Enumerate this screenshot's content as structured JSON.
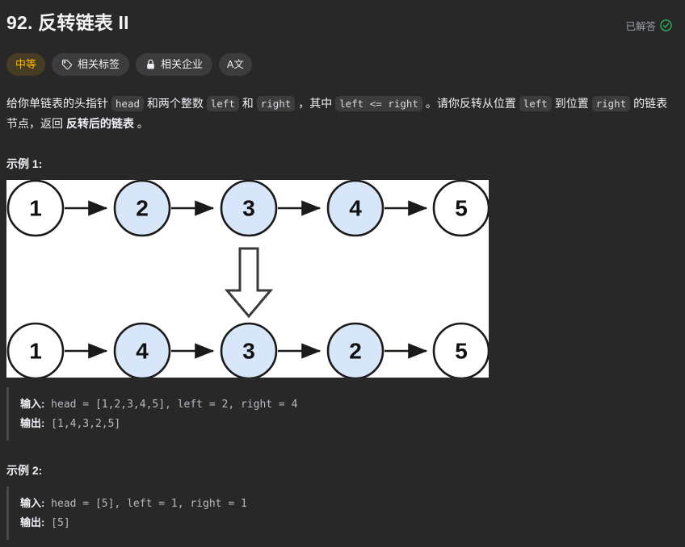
{
  "header": {
    "title": "92. 反转链表 II",
    "status_label": "已解答",
    "status_icon": "check-circle-icon",
    "status_color": "#2db55d"
  },
  "pills": [
    {
      "label": "中等",
      "icon": null,
      "kind": "difficulty",
      "color": "#ffb800"
    },
    {
      "label": "相关标签",
      "icon": "tag-icon",
      "kind": "normal"
    },
    {
      "label": "相关企业",
      "icon": "lock-icon",
      "kind": "normal"
    },
    {
      "label": "A文",
      "icon": null,
      "kind": "icon-only"
    }
  ],
  "description": {
    "seg1": "给你单链表的头指针 ",
    "code1": "head",
    "seg2": " 和两个整数 ",
    "code2": "left",
    "seg3": " 和 ",
    "code3": "right",
    "seg4": " ，其中 ",
    "code4": "left <= right",
    "seg5": " 。请你反转从位置 ",
    "code5": "left",
    "seg6": " 到位置 ",
    "code6": "right",
    "seg7": " 的链表节点，返回 ",
    "bold1": "反转后的链表",
    "seg8": " 。"
  },
  "examples": [
    {
      "heading": "示例 1:",
      "input_label": "输入:",
      "input_value": " head = [1,2,3,4,5], left = 2, right = 4",
      "output_label": "输出:",
      "output_value": " [1,4,3,2,5]"
    },
    {
      "heading": "示例 2:",
      "input_label": "输入:",
      "input_value": " head = [5], left = 1, right = 1",
      "output_label": "输出:",
      "output_value": " [5]"
    }
  ],
  "figure": {
    "alt": "链表反转示意图",
    "node_fill_highlight": "#d7e6f8",
    "node_fill_plain": "#ffffff",
    "stroke": "#1a1a1a",
    "background": "#ffffff",
    "top_row": [
      {
        "value": "1",
        "highlighted": false
      },
      {
        "value": "2",
        "highlighted": true
      },
      {
        "value": "3",
        "highlighted": true
      },
      {
        "value": "4",
        "highlighted": true
      },
      {
        "value": "5",
        "highlighted": false
      }
    ],
    "bottom_row": [
      {
        "value": "1",
        "highlighted": false
      },
      {
        "value": "4",
        "highlighted": true
      },
      {
        "value": "3",
        "highlighted": true
      },
      {
        "value": "2",
        "highlighted": true
      },
      {
        "value": "5",
        "highlighted": false
      }
    ],
    "transform_arrow": "down-arrow-outline"
  }
}
